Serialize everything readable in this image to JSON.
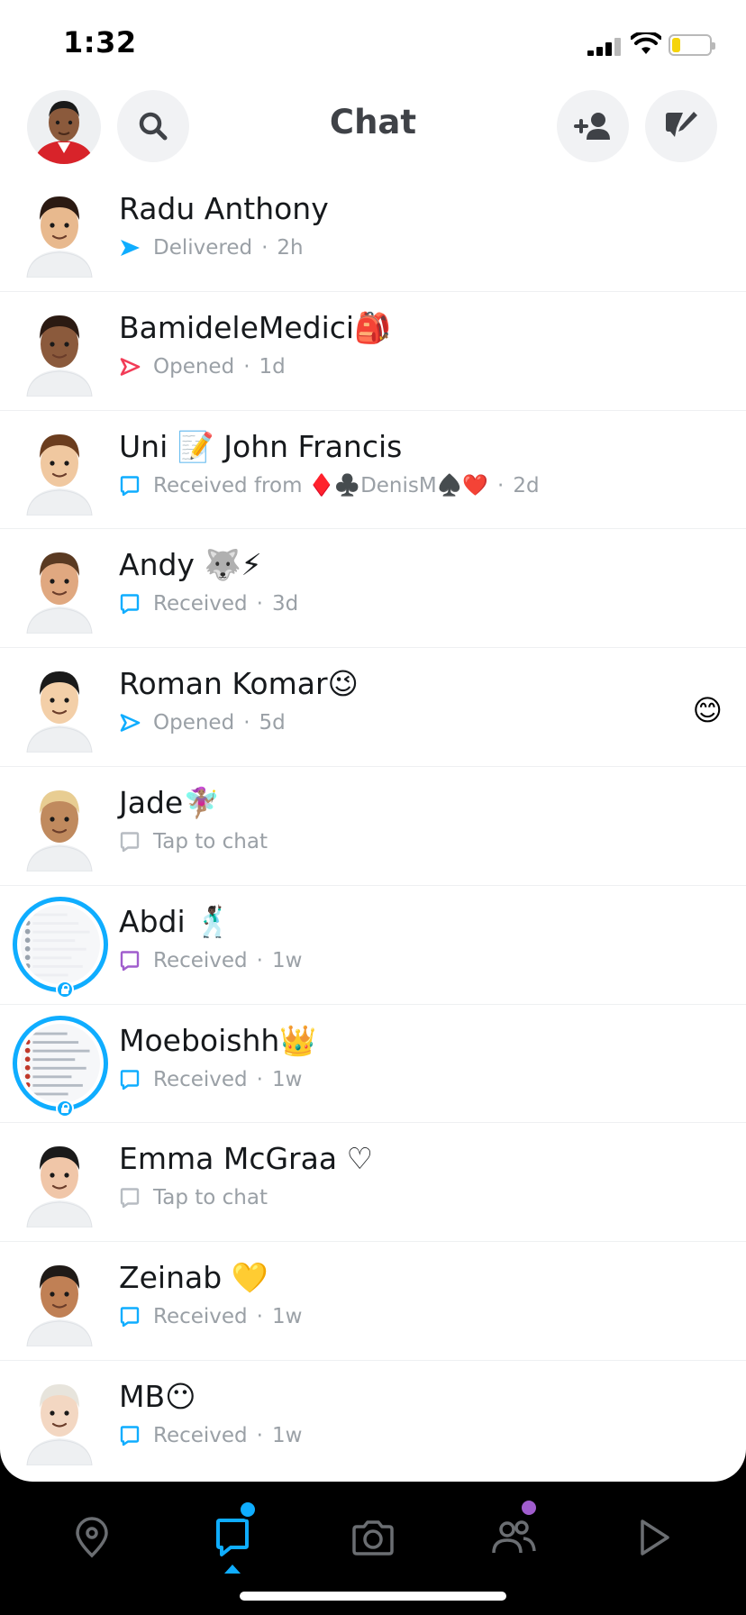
{
  "status_bar": {
    "time": "1:32",
    "battery_level": 0.22
  },
  "header": {
    "title": "Chat"
  },
  "chats": [
    {
      "name": "Radu Anthony",
      "status": "Delivered",
      "time": "2h",
      "status_icon": "send-filled-icon",
      "status_color": "#0fadff",
      "avatar_skin": "#e8b98e",
      "avatar_hair": "#2b1a12",
      "story": false
    },
    {
      "name": "BamideleMedici🎒",
      "status": "Opened",
      "time": "1d",
      "status_icon": "send-outline-icon",
      "status_color": "#f23c57",
      "avatar_skin": "#8b5a3c",
      "avatar_hair": "#2b1a12",
      "story": false
    },
    {
      "name": "Uni 📝 John Francis",
      "status": "Received from ♦️♣️DenisM♠️❤️",
      "time": "2d",
      "status_icon": "chat-outline-icon",
      "status_color": "#0fadff",
      "avatar_skin": "#f0c8a0",
      "avatar_hair": "#6b3d1e",
      "story": false
    },
    {
      "name": "Andy 🐺⚡",
      "status": "Received",
      "time": "3d",
      "status_icon": "chat-outline-icon",
      "status_color": "#0fadff",
      "avatar_skin": "#e0a880",
      "avatar_hair": "#5a3a22",
      "story": false
    },
    {
      "name": "Roman Komar😉",
      "status": "Opened",
      "time": "5d",
      "status_icon": "send-outline-icon",
      "status_color": "#0fadff",
      "avatar_skin": "#f3cfa8",
      "avatar_hair": "#1a1a1a",
      "story": false,
      "reaction": "😊"
    },
    {
      "name": "Jade🧚🏽‍♀️",
      "status": "Tap to chat",
      "time": "",
      "status_icon": "chat-outline-icon",
      "status_color": "#b7bcc2",
      "avatar_skin": "#c08a5e",
      "avatar_hair": "#e8cd92",
      "story": false
    },
    {
      "name": "Abdi 🕺🏿",
      "status": "Received",
      "time": "1w",
      "status_icon": "chat-outline-icon",
      "status_color": "#a05dcd",
      "avatar_skin": "#e5e8ec",
      "avatar_hair": "#9aa3ad",
      "story": true
    },
    {
      "name": "Moeboishh👑",
      "status": "Received",
      "time": "1w",
      "status_icon": "chat-outline-icon",
      "status_color": "#0fadff",
      "avatar_skin": "#7d8a99",
      "avatar_hair": "#c0392b",
      "story": true
    },
    {
      "name": "Emma McGraa ♡",
      "status": "Tap to chat",
      "time": "",
      "status_icon": "chat-outline-icon",
      "status_color": "#b7bcc2",
      "avatar_skin": "#f0c6a8",
      "avatar_hair": "#1a1a1a",
      "story": false
    },
    {
      "name": "Zeinab 💛",
      "status": "Received",
      "time": "1w",
      "status_icon": "chat-outline-icon",
      "status_color": "#0fadff",
      "avatar_skin": "#c08055",
      "avatar_hair": "#1f1a17",
      "story": false
    },
    {
      "name": "MB😶",
      "status": "Received",
      "time": "1w",
      "status_icon": "chat-outline-icon",
      "status_color": "#0fadff",
      "avatar_skin": "#f3d7c2",
      "avatar_hair": "#e7e4dc",
      "story": false
    }
  ],
  "bottom_nav": [
    {
      "name": "map",
      "icon": "map-pin-icon",
      "active": false
    },
    {
      "name": "chat",
      "icon": "chat-bubble-icon",
      "active": true,
      "badge_color": "#0fadff"
    },
    {
      "name": "camera",
      "icon": "camera-icon",
      "active": false
    },
    {
      "name": "stories",
      "icon": "friends-icon",
      "active": false,
      "badge_color": "#a05dcd"
    },
    {
      "name": "spotlight",
      "icon": "play-icon",
      "active": false
    }
  ],
  "colors": {
    "accent": "#0fadff",
    "title": "#3f4247",
    "muted": "#9aa0a6"
  }
}
